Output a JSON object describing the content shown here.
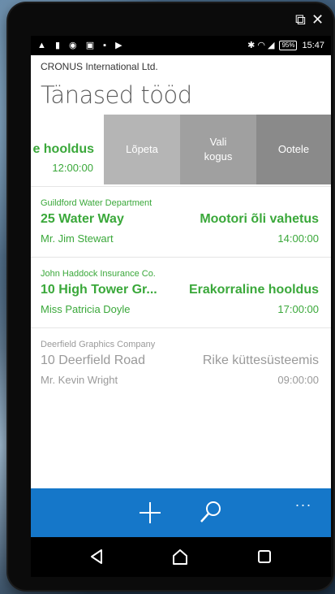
{
  "window": {
    "top_controls": [
      "⧉",
      "✕"
    ]
  },
  "status_bar": {
    "left_icons": "▲ ▮ ◉ ▣ ▪ ▶",
    "right_icons": "✱ ◠ ◢",
    "battery": "95%",
    "time": "15:47"
  },
  "header": {
    "company": "CRONUS International Ltd.",
    "title": "Tänased tööd"
  },
  "swiped_item": {
    "task_fragment": "e hooldus",
    "time": "12:00:00"
  },
  "swipe_actions": [
    {
      "label": "Lõpeta",
      "color": "#b5b5b5"
    },
    {
      "label": "Vali kogus",
      "color": "#a0a0a0"
    },
    {
      "label": "Ootele",
      "color": "#8a8a8a"
    }
  ],
  "jobs": [
    {
      "customer": "Guildford Water Department",
      "address": "25 Water Way",
      "task": "Mootori õli vahetus",
      "contact": "Mr. Jim Stewart",
      "time": "14:00:00",
      "color": "#3aa83a"
    },
    {
      "customer": "John Haddock Insurance Co.",
      "address": "10 High Tower Gr...",
      "task": "Erakorraline hooldus",
      "contact": "Miss Patricia Doyle",
      "time": "17:00:00",
      "color": "#3aa83a"
    },
    {
      "customer": "Deerfield Graphics Company",
      "address": "10 Deerfield Road",
      "task": "Rike küttesüsteemis",
      "contact": "Mr. Kevin Wright",
      "time": "09:00:00",
      "color": "#9a9a9a"
    }
  ],
  "app_bar": {
    "add_icon": "plus-icon",
    "search_icon": "search-icon",
    "more": "...",
    "color": "#1577c9"
  },
  "nav_bar": {
    "back": "back-icon",
    "home": "home-icon",
    "recents": "recents-icon"
  }
}
